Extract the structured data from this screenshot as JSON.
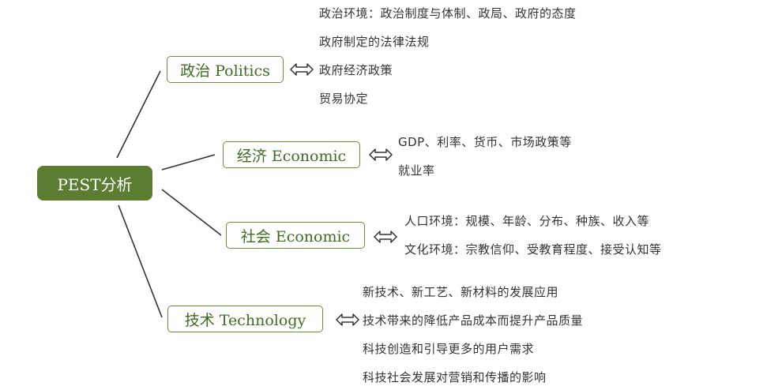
{
  "center": {
    "label": "PEST分析"
  },
  "branches": [
    {
      "label": "政治 Politics",
      "details": [
        "政治环境：政治制度与体制、政局、政府的态度",
        "政府制定的法律法规",
        "政府经济政策",
        "贸易协定"
      ]
    },
    {
      "label": "经济 Economic",
      "details": [
        "GDP、利率、货币、市场政策等",
        "就业率"
      ]
    },
    {
      "label": "社会 Economic",
      "details": [
        "人口环境：规模、年龄、分布、种族、收入等",
        "文化环境：宗教信仰、受教育程度、接受认知等"
      ]
    },
    {
      "label": "技术 Technology",
      "details": [
        "新技术、新工艺、新材料的发展应用",
        "技术带来的降低产品成本而提升产品质量",
        "科技创造和引导更多的用户需求",
        "科技社会发展对营销和传播的影响"
      ]
    }
  ]
}
